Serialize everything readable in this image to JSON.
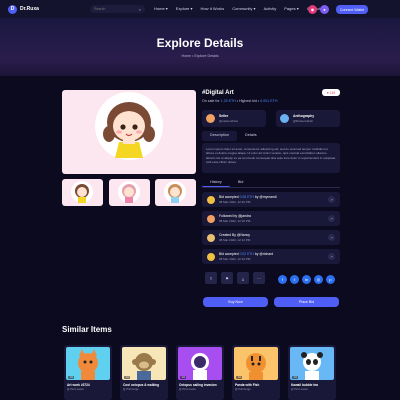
{
  "nav": {
    "logo_text": "Dr.Ruxa",
    "search_placeholder": "Search",
    "menu": [
      "Home ▾",
      "Explore ▾",
      "How It Works",
      "Community ▾",
      "Activity",
      "Pages ▾",
      "Contact"
    ],
    "wallet_label": "Connect Wallet"
  },
  "hero": {
    "title": "Explore Details",
    "breadcrumb_home": "Home",
    "breadcrumb_sep": "•",
    "breadcrumb_current": "Explore Details"
  },
  "item": {
    "title": "#Digital Art",
    "likes": "♥ 145",
    "on_sale_prefix": "On sale for",
    "price_eth": "1.25 ETH",
    "highest_bid_prefix": "• Highest bid •",
    "highest_bid": "0.001 ETH",
    "seller_role": "Seller",
    "seller_name": "@nelsonshaw",
    "creator_role": "Anthography",
    "creator_name": "@RebeccaFeb",
    "tabs": [
      "Description",
      "Details"
    ],
    "description": "Lorem ipsum dolor sit amet, consectetur adipiscing elit, sed do eiusmod tempor incididunt ut labore et dolore magna aliqua. Ut enim ad minim veniam, quis nostrud exercitation ullamco laboris nisi ut aliquip ex ea commodo consequat duis aute irure dolor in reprehenderit in voluptate velit esse cillum dolore."
  },
  "history": {
    "tabs": [
      "History",
      "Bid"
    ],
    "rows": [
      {
        "title_pre": "Bid accepted",
        "amount": "0.08 ETH",
        "title_post": "by @mymandi",
        "time": "08 Mar 2022, 12:20 PM"
      },
      {
        "title_pre": "Followed by",
        "amount": "",
        "title_post": "@jandra",
        "time": "08 Mar 2022, 12:15 PM"
      },
      {
        "title_pre": "Created By",
        "amount": "",
        "title_post": "@Nancy",
        "time": "08 Mar 2022, 12:12 PM"
      },
      {
        "title_pre": "Bid accepted",
        "amount": "0.02 ETH",
        "title_post": "by @richard",
        "time": "08 Mar 2022, 12:10 PM"
      }
    ]
  },
  "actions": {
    "buy": "Buy Now",
    "bid": "Place Bid"
  },
  "similar": {
    "title": "Similar Items",
    "items": [
      {
        "name": "Art work #3724",
        "sub": "@ Pinto Laura",
        "color": "#5fd0f0",
        "tag": "1/1"
      },
      {
        "name": "Cool octopus & walking",
        "sub": "@ Poll Gorge",
        "color": "#f6e6b8",
        "tag": "1/1"
      },
      {
        "name": "Octopus sailing invasion",
        "sub": "@ Pinto Laura",
        "color": "#a84ef0",
        "tag": "1/1"
      },
      {
        "name": "Panda with Fish",
        "sub": "@ Poll Gorge",
        "color": "#fbc36a",
        "tag": "1/1"
      },
      {
        "name": "Kawaii bubble tea",
        "sub": "@ Pinto Laura",
        "color": "#67b8f5",
        "tag": "1/1"
      }
    ]
  }
}
